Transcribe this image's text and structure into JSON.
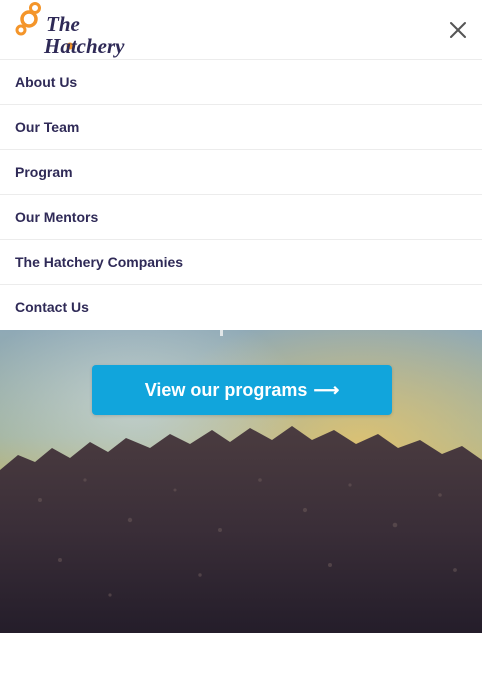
{
  "header": {
    "logo": {
      "line1": "The",
      "line2": "Hatchery"
    },
    "close_icon": "close-icon"
  },
  "menu": {
    "items": [
      {
        "label": "About Us"
      },
      {
        "label": "Our Team"
      },
      {
        "label": "Program"
      },
      {
        "label": "Our Mentors"
      },
      {
        "label": "The Hatchery Companies"
      },
      {
        "label": "Contact Us"
      }
    ]
  },
  "hero": {
    "cta_label": "View our programs",
    "cta_arrow": "⟶"
  },
  "colors": {
    "brand_orange": "#f4952a",
    "brand_navy": "#2f2a57",
    "cta_blue": "#11a5dc"
  }
}
